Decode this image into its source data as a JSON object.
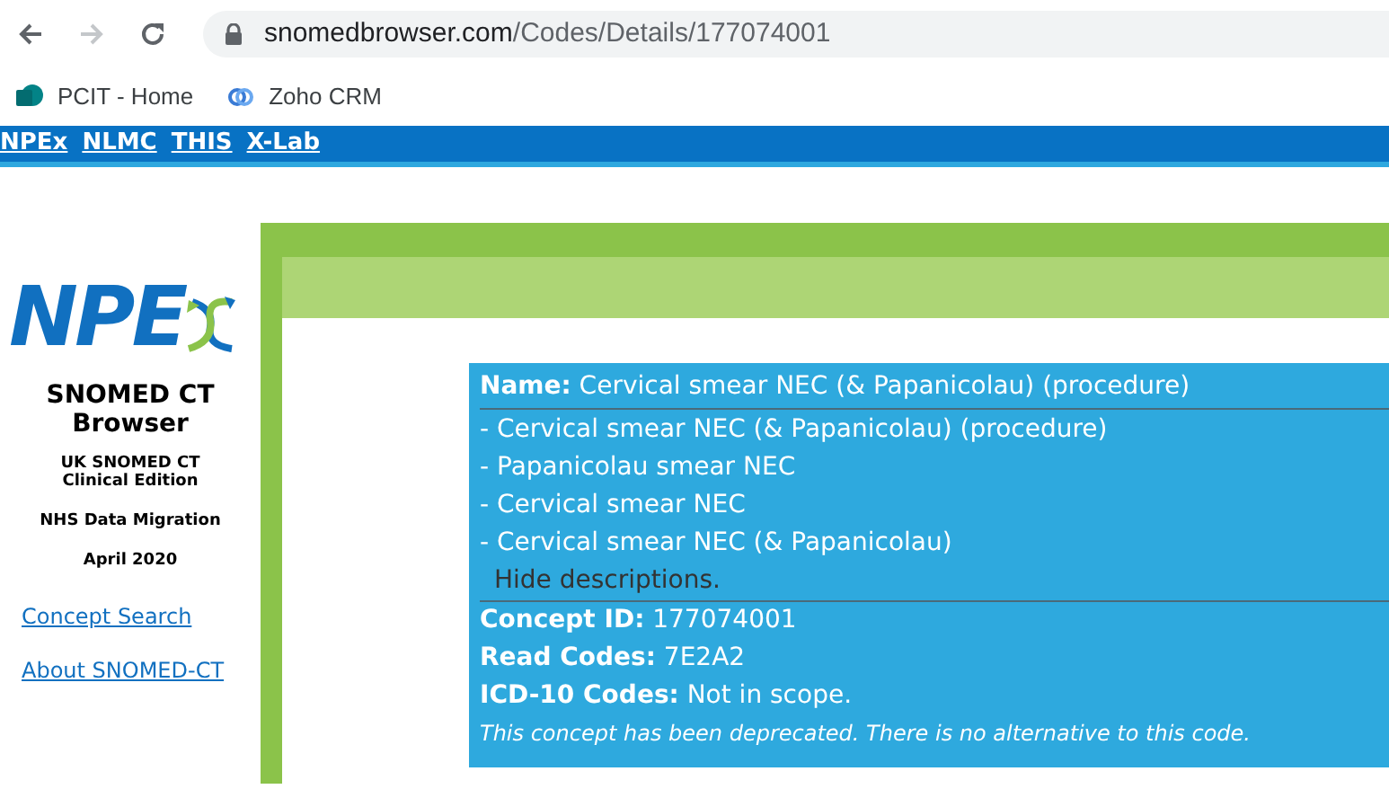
{
  "browser": {
    "url_host": "snomedbrowser.com",
    "url_path": "/Codes/Details/177074001",
    "bookmarks": [
      "PCIT - Home",
      "Zoho CRM"
    ]
  },
  "nav_links": [
    "NPEx",
    "NLMC",
    "THIS",
    "X-Lab"
  ],
  "sidebar": {
    "logo": "NPE",
    "title": "SNOMED CT Browser",
    "edition": "UK SNOMED CT Clinical Edition",
    "subtitle": "NHS Data Migration",
    "date": "April 2020",
    "links": [
      "Concept Search",
      "About SNOMED-CT"
    ]
  },
  "concept": {
    "name": "**Name:** Cervical smear NEC (& Papanicolau) (procedure)",
    "descriptions": [
      "- Cervical smear NEC (& Papanicolau) (procedure)",
      "- Papanicolau smear NEC",
      "- Cervical smear NEC",
      "- Cervical smear NEC (& Papanicolau)"
    ],
    "toggle": "Hide descriptions.",
    "fields": [
      "**Concept ID:** 177074001",
      "**Read Codes:** 7E2A2",
      "**ICD-10 Codes:** Not in scope."
    ],
    "note": "This concept has been deprecated. There is no alternative to this code."
  }
}
